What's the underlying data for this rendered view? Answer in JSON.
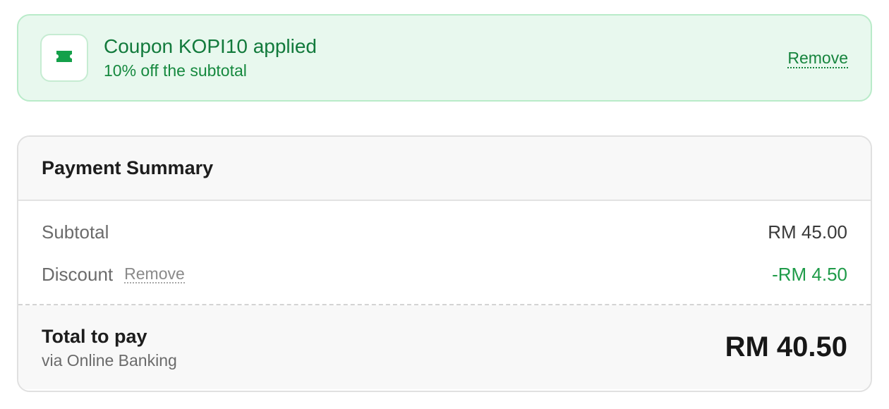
{
  "coupon": {
    "icon": "ticket-icon",
    "title": "Coupon KOPI10 applied",
    "subtitle": "10% off the subtotal",
    "remove_label": "Remove",
    "accent_color": "#127a3c",
    "background_color": "#e8f8ee"
  },
  "summary": {
    "title": "Payment Summary",
    "subtotal": {
      "label": "Subtotal",
      "value": "RM 45.00"
    },
    "discount": {
      "label": "Discount",
      "remove_label": "Remove",
      "value": "-RM 4.50",
      "color": "#1f9b49"
    },
    "total": {
      "label": "Total to pay",
      "method": "via Online Banking",
      "value": "RM 40.50"
    }
  }
}
